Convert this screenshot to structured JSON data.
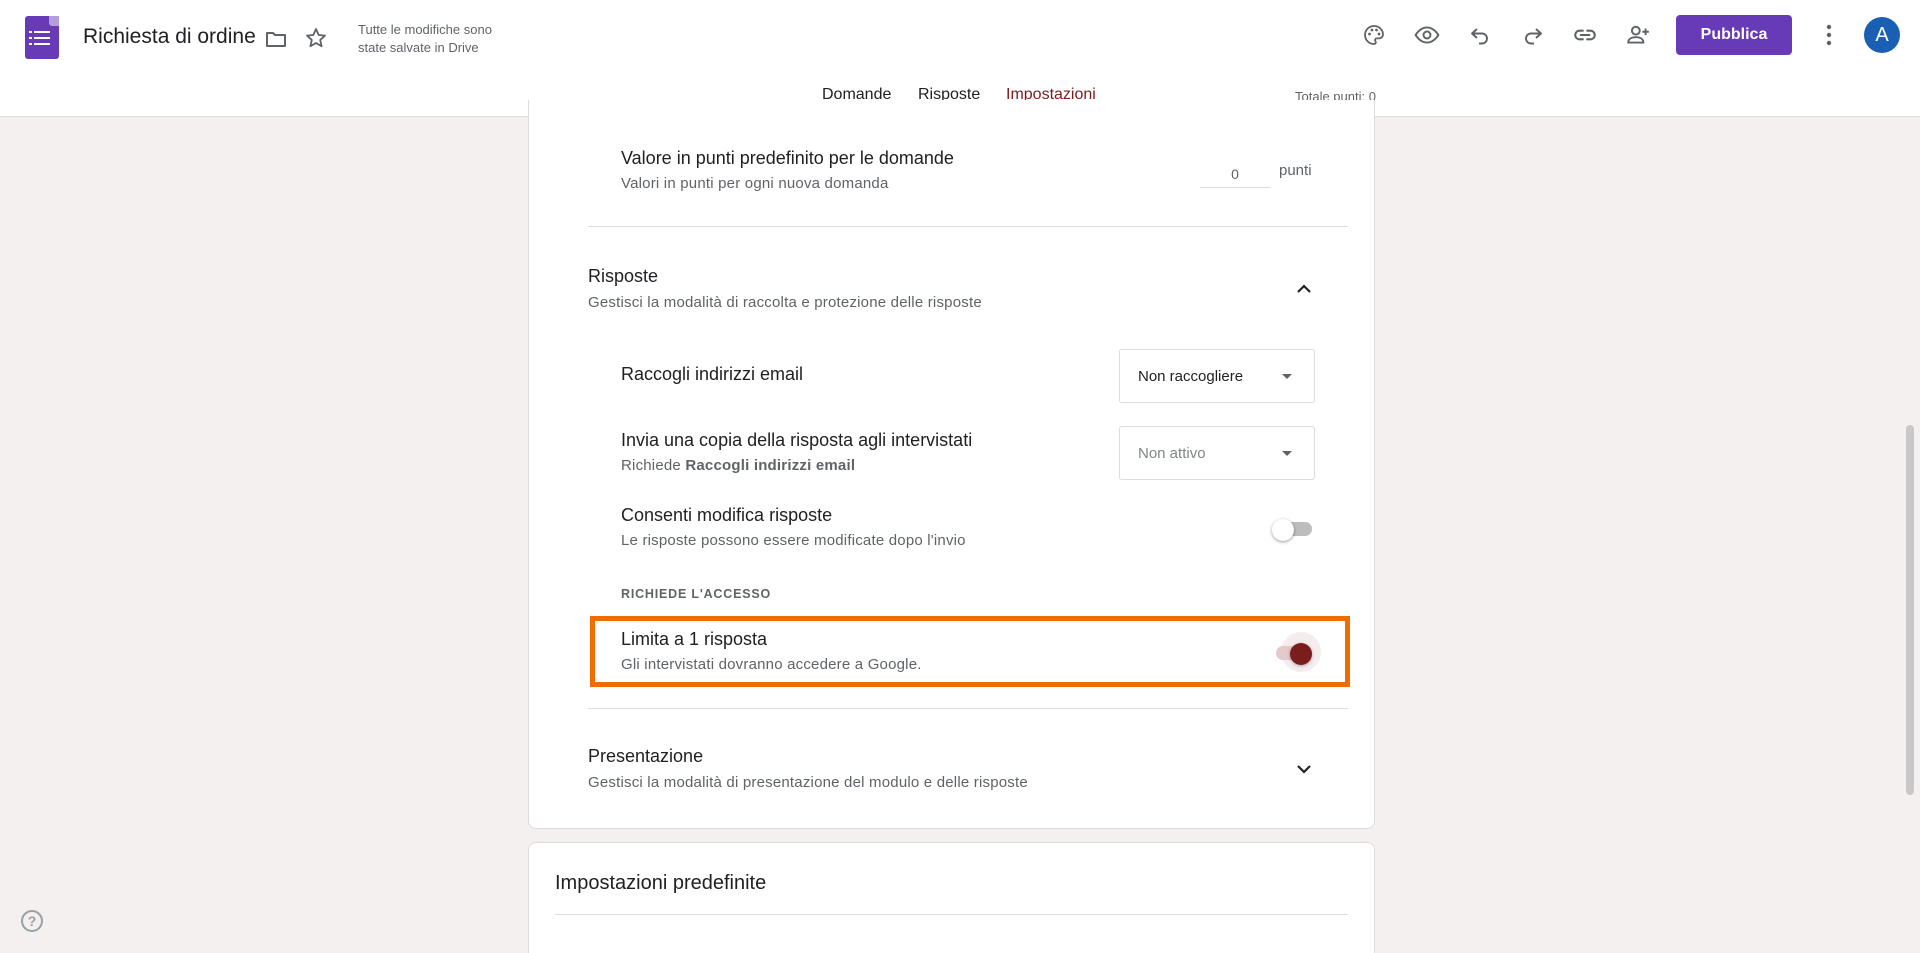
{
  "header": {
    "doc_title": "Richiesta di ordine",
    "save_status_line1": "Tutte le modifiche sono",
    "save_status_line2": "state salvate in Drive",
    "publish_label": "Pubblica",
    "avatar_letter": "A",
    "tabs": [
      {
        "label": "Domande",
        "active": false
      },
      {
        "label": "Risposte",
        "active": false
      },
      {
        "label": "Impostazioni",
        "active": true
      }
    ],
    "total_points": "Totale punti: 0"
  },
  "quiz": {
    "default_points_title": "Valore in punti predefinito per le domande",
    "default_points_sub": "Valori in punti per ogni nuova domanda",
    "default_points_value": "0",
    "points_unit": "punti"
  },
  "responses": {
    "title": "Risposte",
    "subtitle": "Gestisci la modalità di raccolta e protezione delle risposte",
    "collect_email_title": "Raccogli indirizzi email",
    "collect_email_value": "Non raccogliere",
    "send_copy_title": "Invia una copia della risposta agli intervistati",
    "send_copy_sub_prefix": "Richiede ",
    "send_copy_sub_bold": "Raccogli indirizzi email",
    "send_copy_value": "Non attivo",
    "allow_edit_title": "Consenti modifica risposte",
    "allow_edit_sub": "Le risposte possono essere modificate dopo l'invio",
    "allow_edit_on": false,
    "requires_login_label": "RICHIEDE L'ACCESSO",
    "limit_title": "Limita a 1 risposta",
    "limit_sub": "Gli intervistati dovranno accedere a Google.",
    "limit_on": true
  },
  "presentation": {
    "title": "Presentazione",
    "subtitle": "Gestisci la modalità di presentazione del modulo e delle risposte"
  },
  "defaults": {
    "title": "Impostazioni predefinite"
  },
  "help_label": "?",
  "colors": {
    "accent": "#673ab7",
    "active_tab": "#7c1d1d",
    "highlight": "#ef6c00"
  }
}
